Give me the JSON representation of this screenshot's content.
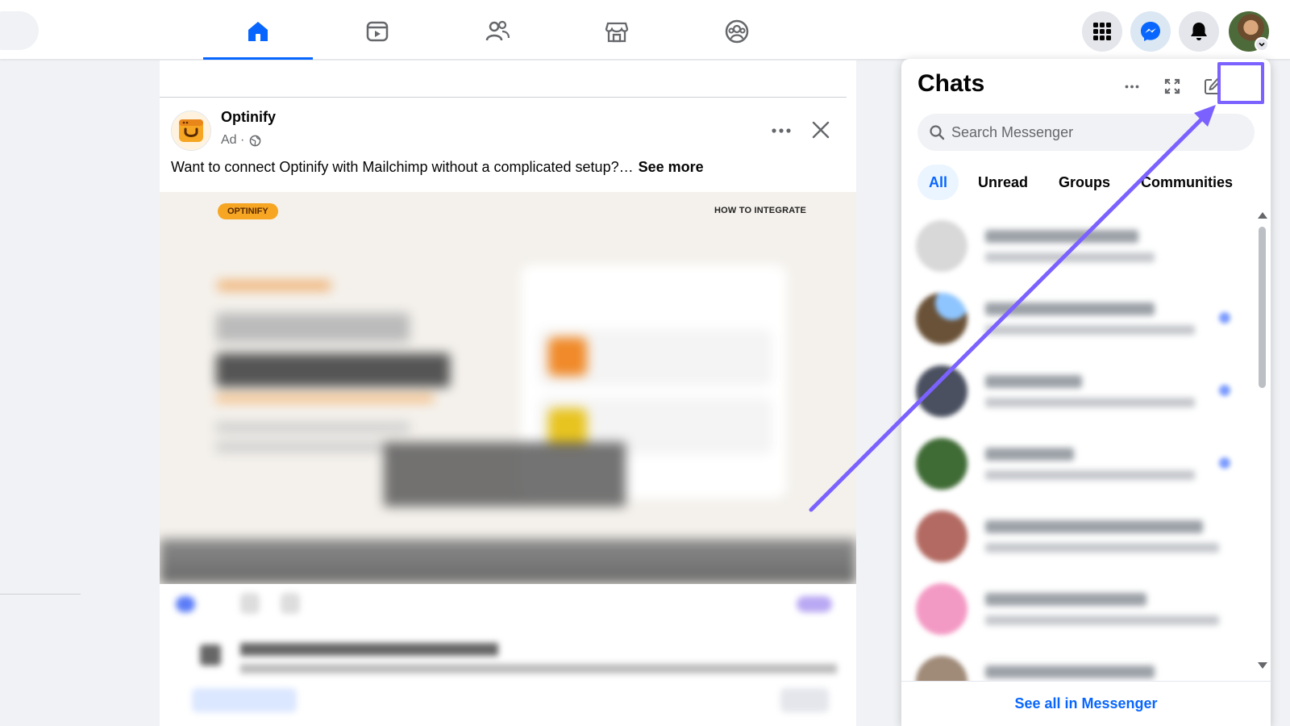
{
  "nav": {
    "tabs": [
      {
        "name": "home",
        "active": true
      },
      {
        "name": "video"
      },
      {
        "name": "friends"
      },
      {
        "name": "marketplace"
      },
      {
        "name": "groups"
      }
    ],
    "right_buttons": [
      "menu-grid-icon",
      "messenger-icon",
      "notifications-bell-icon"
    ],
    "accent": "#0866ff"
  },
  "post": {
    "author": "Optinify",
    "meta": "Ad ·",
    "text": "Want to connect Optinify with Mailchimp without a complicated setup?…",
    "see_more": "See more",
    "media": {
      "badge": "OPTINIFY",
      "howto": "HOW TO INTEGRATE"
    }
  },
  "chats": {
    "title": "Chats",
    "search_placeholder": "Search Messenger",
    "filters": [
      {
        "label": "All",
        "active": true
      },
      {
        "label": "Unread"
      },
      {
        "label": "Groups"
      },
      {
        "label": "Communities"
      }
    ],
    "see_all": "See all in Messenger",
    "highlight_color": "#7b61ff"
  }
}
